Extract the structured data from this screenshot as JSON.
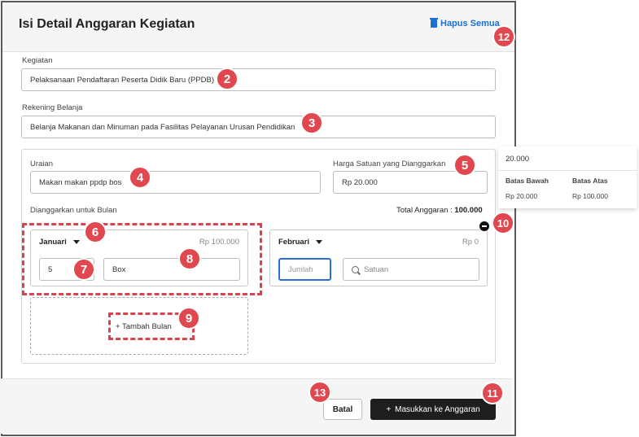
{
  "header": {
    "title": "Isi Detail Anggaran Kegiatan",
    "delete_all": "Hapus Semua"
  },
  "form": {
    "kegiatan_label": "Kegiatan",
    "kegiatan_value": "Pelaksanaan Pendaftaran Peserta Didik Baru (PPDB)",
    "rekening_label": "Rekening Belanja",
    "rekening_value": "Belanja Makanan dan Minuman pada Fasilitas Pelayanan Urusan Pendidikan",
    "uraian_label": "Uraian",
    "uraian_value": "Makan makan ppdp bos",
    "harga_label": "Harga Satuan yang Dianggarkan",
    "harga_value": "Rp 20.000",
    "bulan_label": "Dianggarkan untuk Bulan",
    "total_label": "Total Anggaran :",
    "total_value": "100.000"
  },
  "months": [
    {
      "name": "Januari",
      "amount": "Rp 100.000",
      "qty": "5",
      "unit": "Box"
    },
    {
      "name": "Februari",
      "amount": "Rp 0",
      "qty_placeholder": "Jumlah",
      "unit_placeholder": "Satuan"
    }
  ],
  "add_month": "+ Tambah Bulan",
  "tooltip": {
    "value": "20.000",
    "lower_label": "Batas Bawah",
    "upper_label": "Batas Atas",
    "lower_value": "Rp 20.000",
    "upper_value": "Rp 100.000"
  },
  "footer": {
    "cancel": "Batal",
    "submit": "Masukkan ke Anggaran"
  },
  "badges": [
    "2",
    "3",
    "4",
    "5",
    "6",
    "7",
    "8",
    "9",
    "10",
    "11",
    "12",
    "13"
  ],
  "colors": {
    "accent": "#1a6fd0",
    "badge": "#e0474f",
    "focus": "#2b6fd6",
    "primary_button": "#1e1e1e"
  }
}
